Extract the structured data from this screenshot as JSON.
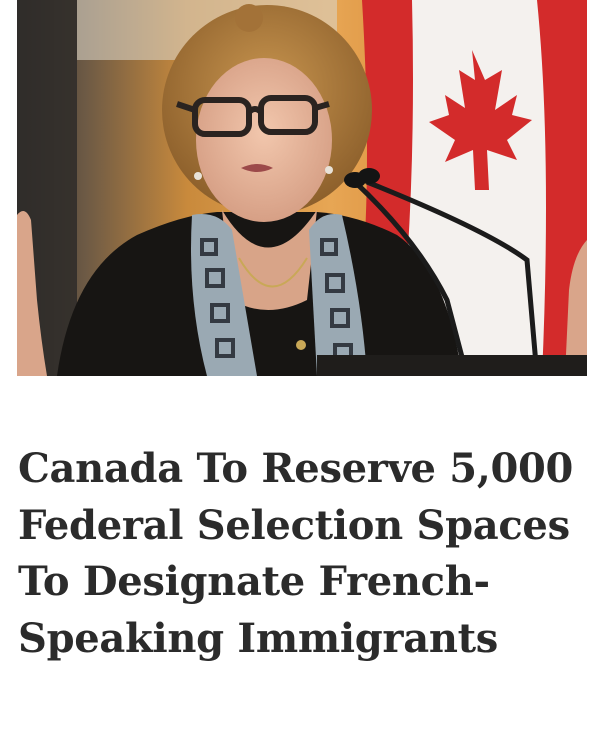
{
  "article": {
    "headline": "Canada To Reserve 5,000 Federal Selection Spaces To Designate French-Speaking Immigrants"
  },
  "photo": {
    "subject": "woman-speaking-at-podium",
    "background": "canadian-flag"
  },
  "colors": {
    "flag_red": "#d32b2b",
    "headline_text": "#2b2b2b",
    "background": "#ffffff"
  }
}
